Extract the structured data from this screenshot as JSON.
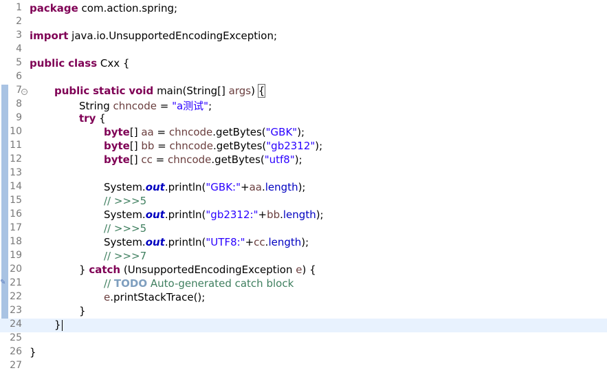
{
  "editor": {
    "lines": [
      {
        "n": "1"
      },
      {
        "n": "2"
      },
      {
        "n": "3"
      },
      {
        "n": "4"
      },
      {
        "n": "5"
      },
      {
        "n": "6"
      },
      {
        "n": "7"
      },
      {
        "n": "8"
      },
      {
        "n": "9"
      },
      {
        "n": "10"
      },
      {
        "n": "11"
      },
      {
        "n": "12"
      },
      {
        "n": "13"
      },
      {
        "n": "14"
      },
      {
        "n": "15"
      },
      {
        "n": "16"
      },
      {
        "n": "17"
      },
      {
        "n": "18"
      },
      {
        "n": "19"
      },
      {
        "n": "20"
      },
      {
        "n": "21"
      },
      {
        "n": "22"
      },
      {
        "n": "23"
      },
      {
        "n": "24"
      },
      {
        "n": "25"
      },
      {
        "n": "26"
      },
      {
        "n": "27"
      }
    ],
    "text": {
      "package_kw": "package",
      "package_name": " com.action.spring;",
      "import_kw": "import",
      "import_name": " java.io.UnsupportedEncodingException;",
      "public_kw": "public",
      "class_kw": "class",
      "class_name": " Cxx {",
      "static_kw": "static",
      "void_kw": "void",
      "main_sig_a": " main(String[] ",
      "args": "args",
      "main_sig_b": ") ",
      "open_brace": "{",
      "string_type": "String ",
      "chncode": "chncode",
      "assign": " = ",
      "str_a_test": "\"a测试\"",
      "semi": ";",
      "try_kw": "try",
      "try_rest": " {",
      "byte_kw": "byte",
      "arr_aa": "[] ",
      "aa": "aa",
      "bb": "bb",
      "cc": "cc",
      "getbytes_open": ".getBytes(",
      "str_gbk": "\"GBK\"",
      "str_gb2312": "\"gb2312\"",
      "str_utf8": "\"utf8\"",
      "close_semi": ");",
      "system": "System.",
      "out": "out",
      "println_open": ".println(",
      "str_gbk_colon": "\"GBK:\"",
      "str_gb2312_colon": "\"gb2312:\"",
      "str_utf8_colon": "\"UTF8:\"",
      "plus": "+",
      "dot": ".",
      "length": "length",
      "cmt_5": "// >>>5",
      "cmt_7": "// >>>7",
      "close_catch": "} ",
      "catch_kw": "catch",
      "catch_rest_a": " (UnsupportedEncodingException ",
      "e": "e",
      "catch_rest_b": ") {",
      "cmt_prefix": "// ",
      "todo": "TODO",
      "cmt_todo_rest": " Auto-generated catch block",
      "print_trace": ".printStackTrace();",
      "close_brace": "}"
    }
  },
  "colors": {
    "keyword": "#7f0055",
    "string": "#2a00ff",
    "comment": "#3f7f5f",
    "field": "#0000c0",
    "local_var": "#6a3e3e",
    "current_line": "#e8f2fe",
    "gutter_marker": "#a9c3e3"
  },
  "icons": {
    "fold": "fold-collapse-icon",
    "task": "task-marker-icon"
  }
}
